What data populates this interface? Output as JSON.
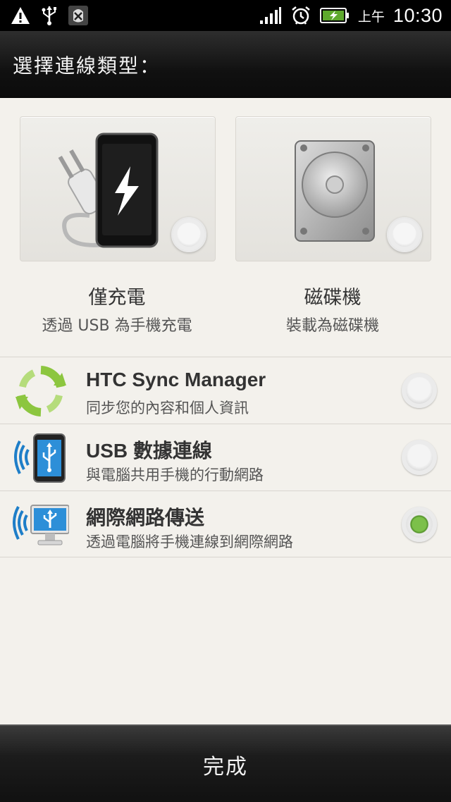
{
  "status_bar": {
    "icons_left": [
      "warning-icon",
      "usb-icon",
      "debug-bug-icon"
    ],
    "icons_right": [
      "signal-icon",
      "alarm-icon",
      "battery-charging-icon"
    ],
    "ampm": "上午",
    "time": "10:30"
  },
  "header": {
    "title": "選擇連線類型："
  },
  "options": [
    {
      "title": "僅充電",
      "subtitle": "透過 USB 為手機充電",
      "icon": "phone-plug-icon",
      "selected": false
    },
    {
      "title": "磁碟機",
      "subtitle": "裝載為磁碟機",
      "icon": "hard-disk-icon",
      "selected": false
    }
  ],
  "list": [
    {
      "title": "HTC Sync Manager",
      "subtitle": "同步您的內容和個人資訊",
      "icon": "sync-arrows-icon",
      "selected": false
    },
    {
      "title": "USB 數據連線",
      "subtitle": "與電腦共用手機的行動網路",
      "icon": "usb-tether-phone-icon",
      "selected": false
    },
    {
      "title": "網際網路傳送",
      "subtitle": "透過電腦將手機連線到網際網路",
      "icon": "internet-passthrough-monitor-icon",
      "selected": true
    }
  ],
  "footer": {
    "done_label": "完成"
  },
  "colors": {
    "accent_green": "#6cb33f",
    "background": "#f3f1ec"
  }
}
